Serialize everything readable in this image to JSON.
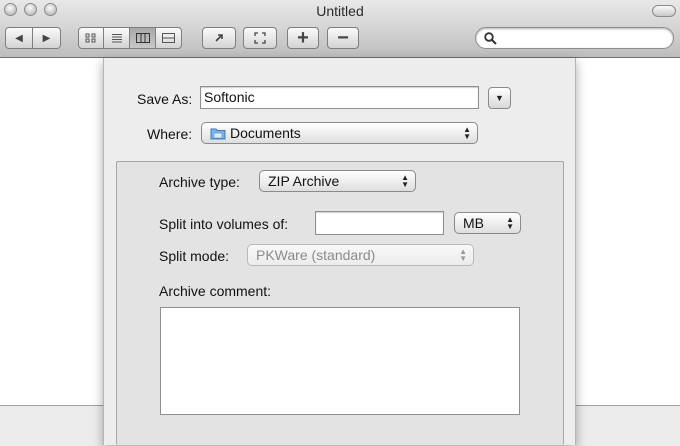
{
  "window": {
    "title": "Untitled"
  },
  "toolbar": {
    "nav": [
      "◀",
      "▶"
    ],
    "views": [
      "icon-view",
      "list-view",
      "column-view",
      "coverflow-view"
    ],
    "add": "+",
    "remove": "−",
    "search_placeholder": ""
  },
  "sheet": {
    "save_as_label": "Save As:",
    "save_as_value": "Softonic",
    "where_label": "Where:",
    "where_value": "Documents",
    "archive_type_label": "Archive type:",
    "archive_type_value": "ZIP Archive",
    "split_label": "Split into volumes of:",
    "split_value": "",
    "unit_value": "MB",
    "split_mode_label": "Split mode:",
    "split_mode_value": "PKWare (standard)",
    "comment_label": "Archive comment:",
    "comment_value": ""
  }
}
